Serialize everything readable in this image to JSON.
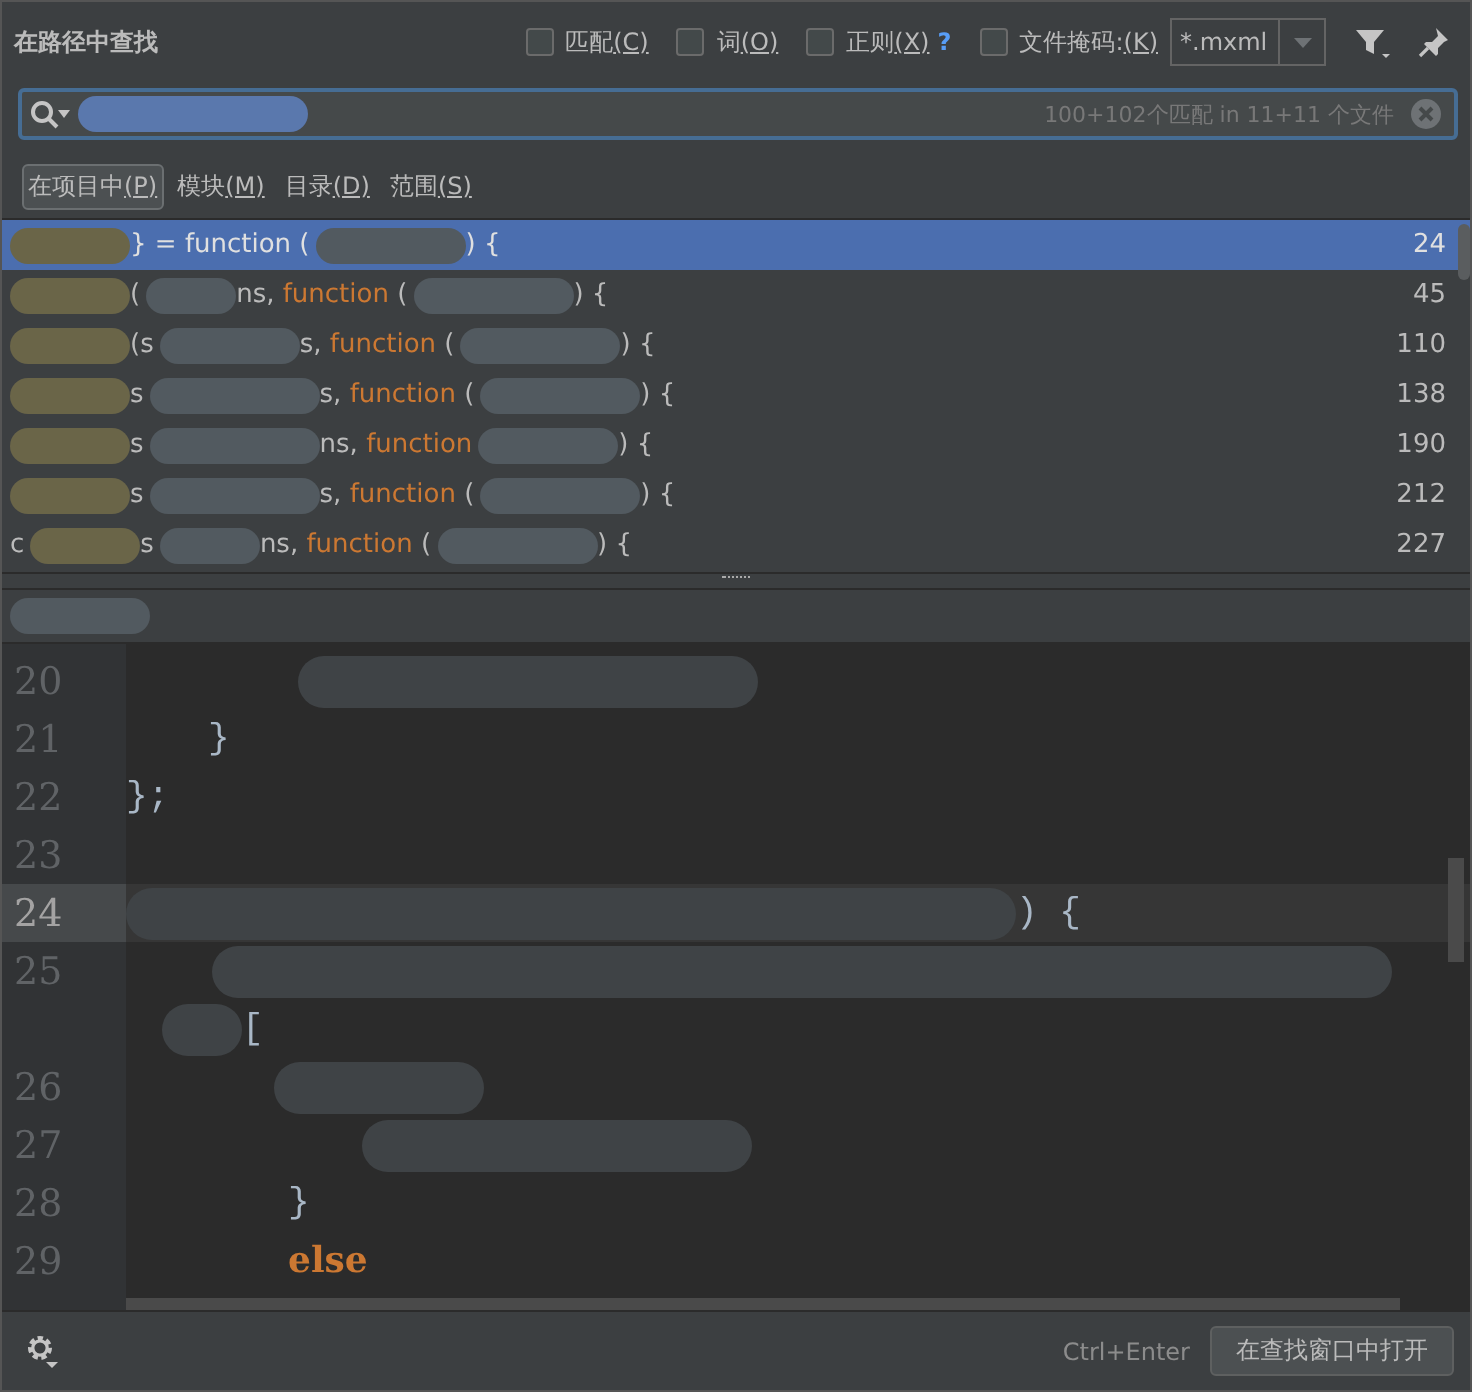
{
  "title": "在路径中查找",
  "options": [
    {
      "label": "匹配",
      "mnemonic": "(C)",
      "checked": false
    },
    {
      "label": "词",
      "mnemonic": "(O)",
      "checked": false
    },
    {
      "label": "正则",
      "mnemonic": "(X)",
      "checked": false,
      "help_text": "?"
    },
    {
      "label": "文件掩码:",
      "mnemonic": "(K)",
      "checked": false
    }
  ],
  "file_mask": {
    "value": "*.mxml"
  },
  "search": {
    "segments": [
      {
        "kind": "redacted"
      }
    ],
    "match_info": "100+102个匹配 in 11+11 个文件"
  },
  "scopes": [
    {
      "label": "在项目中",
      "mnemonic": "(P)",
      "selected": true
    },
    {
      "label": "模块",
      "mnemonic": "(M)",
      "selected": false
    },
    {
      "label": "目录",
      "mnemonic": "(D)",
      "selected": false
    },
    {
      "label": "范围",
      "mnemonic": "(S)",
      "selected": false
    }
  ],
  "results": [
    {
      "selected": true,
      "line": "24",
      "segments": [
        {
          "kind": "redacted"
        },
        {
          "kind": "text",
          "text": "} = "
        },
        {
          "kind": "keyword",
          "text": "function"
        },
        {
          "kind": "text",
          "text": " ("
        },
        {
          "kind": "redacted"
        },
        {
          "kind": "text",
          "text": ") {"
        }
      ]
    },
    {
      "selected": false,
      "line": "45",
      "segments": [
        {
          "kind": "redacted"
        },
        {
          "kind": "text",
          "text": "("
        },
        {
          "kind": "redacted"
        },
        {
          "kind": "text",
          "text": "ns, "
        },
        {
          "kind": "keyword",
          "text": "function"
        },
        {
          "kind": "text",
          "text": " ("
        },
        {
          "kind": "redacted"
        },
        {
          "kind": "text",
          "text": ") {"
        }
      ]
    },
    {
      "selected": false,
      "line": "110",
      "segments": [
        {
          "kind": "redacted"
        },
        {
          "kind": "text",
          "text": "(s"
        },
        {
          "kind": "redacted"
        },
        {
          "kind": "text",
          "text": "s, "
        },
        {
          "kind": "keyword",
          "text": "function"
        },
        {
          "kind": "text",
          "text": " ("
        },
        {
          "kind": "redacted"
        },
        {
          "kind": "text",
          "text": ") {"
        }
      ]
    },
    {
      "selected": false,
      "line": "138",
      "segments": [
        {
          "kind": "redacted"
        },
        {
          "kind": "text",
          "text": "s"
        },
        {
          "kind": "redacted"
        },
        {
          "kind": "text",
          "text": "s, "
        },
        {
          "kind": "keyword",
          "text": "function"
        },
        {
          "kind": "text",
          "text": " ("
        },
        {
          "kind": "redacted"
        },
        {
          "kind": "text",
          "text": ") {"
        }
      ]
    },
    {
      "selected": false,
      "line": "190",
      "segments": [
        {
          "kind": "redacted"
        },
        {
          "kind": "text",
          "text": "s"
        },
        {
          "kind": "redacted"
        },
        {
          "kind": "text",
          "text": "ns, "
        },
        {
          "kind": "keyword",
          "text": "function"
        },
        {
          "kind": "redacted"
        },
        {
          "kind": "text",
          "text": ") {"
        }
      ]
    },
    {
      "selected": false,
      "line": "212",
      "segments": [
        {
          "kind": "redacted"
        },
        {
          "kind": "text",
          "text": "s"
        },
        {
          "kind": "redacted"
        },
        {
          "kind": "text",
          "text": "s, "
        },
        {
          "kind": "keyword",
          "text": "function"
        },
        {
          "kind": "text",
          "text": " ("
        },
        {
          "kind": "redacted"
        },
        {
          "kind": "text",
          "text": ") {"
        }
      ]
    },
    {
      "selected": false,
      "line": "227",
      "segments": [
        {
          "kind": "text",
          "text": "c"
        },
        {
          "kind": "redacted"
        },
        {
          "kind": "text",
          "text": "s"
        },
        {
          "kind": "redacted"
        },
        {
          "kind": "text",
          "text": "ns, "
        },
        {
          "kind": "keyword",
          "text": "function"
        },
        {
          "kind": "text",
          "text": " ("
        },
        {
          "kind": "redacted"
        },
        {
          "kind": "text",
          "text": ") {"
        }
      ]
    }
  ],
  "editor": {
    "path": [
      {
        "kind": "redacted"
      }
    ],
    "lines": [
      {
        "number": "20",
        "current": false,
        "segments": [
          {
            "kind": "redacted"
          }
        ]
      },
      {
        "number": "21",
        "current": false,
        "segments": [
          {
            "kind": "text",
            "text": "}"
          }
        ]
      },
      {
        "number": "22",
        "current": false,
        "segments": [
          {
            "kind": "text",
            "text": "};"
          }
        ]
      },
      {
        "number": "23",
        "current": false
      },
      {
        "number": "24",
        "current": true,
        "segments": [
          {
            "kind": "redacted"
          },
          {
            "kind": "text",
            "text": ") {"
          }
        ]
      },
      {
        "number": "25",
        "current": false,
        "segments": [
          {
            "kind": "redacted"
          }
        ]
      },
      {
        "current": false,
        "segments": [
          {
            "kind": "redacted"
          },
          {
            "kind": "text",
            "text": "["
          }
        ]
      },
      {
        "number": "26",
        "current": false,
        "segments": [
          {
            "kind": "redacted"
          }
        ]
      },
      {
        "number": "27",
        "current": false,
        "segments": [
          {
            "kind": "redacted"
          }
        ]
      },
      {
        "number": "28",
        "current": false,
        "segments": [
          {
            "kind": "text",
            "text": "}"
          }
        ]
      },
      {
        "number": "29",
        "current": false,
        "segments": [
          {
            "kind": "keyword",
            "text": "else"
          }
        ]
      }
    ]
  },
  "footer": {
    "shortcut": "Ctrl+Enter",
    "button": "在查找窗口中打开"
  }
}
